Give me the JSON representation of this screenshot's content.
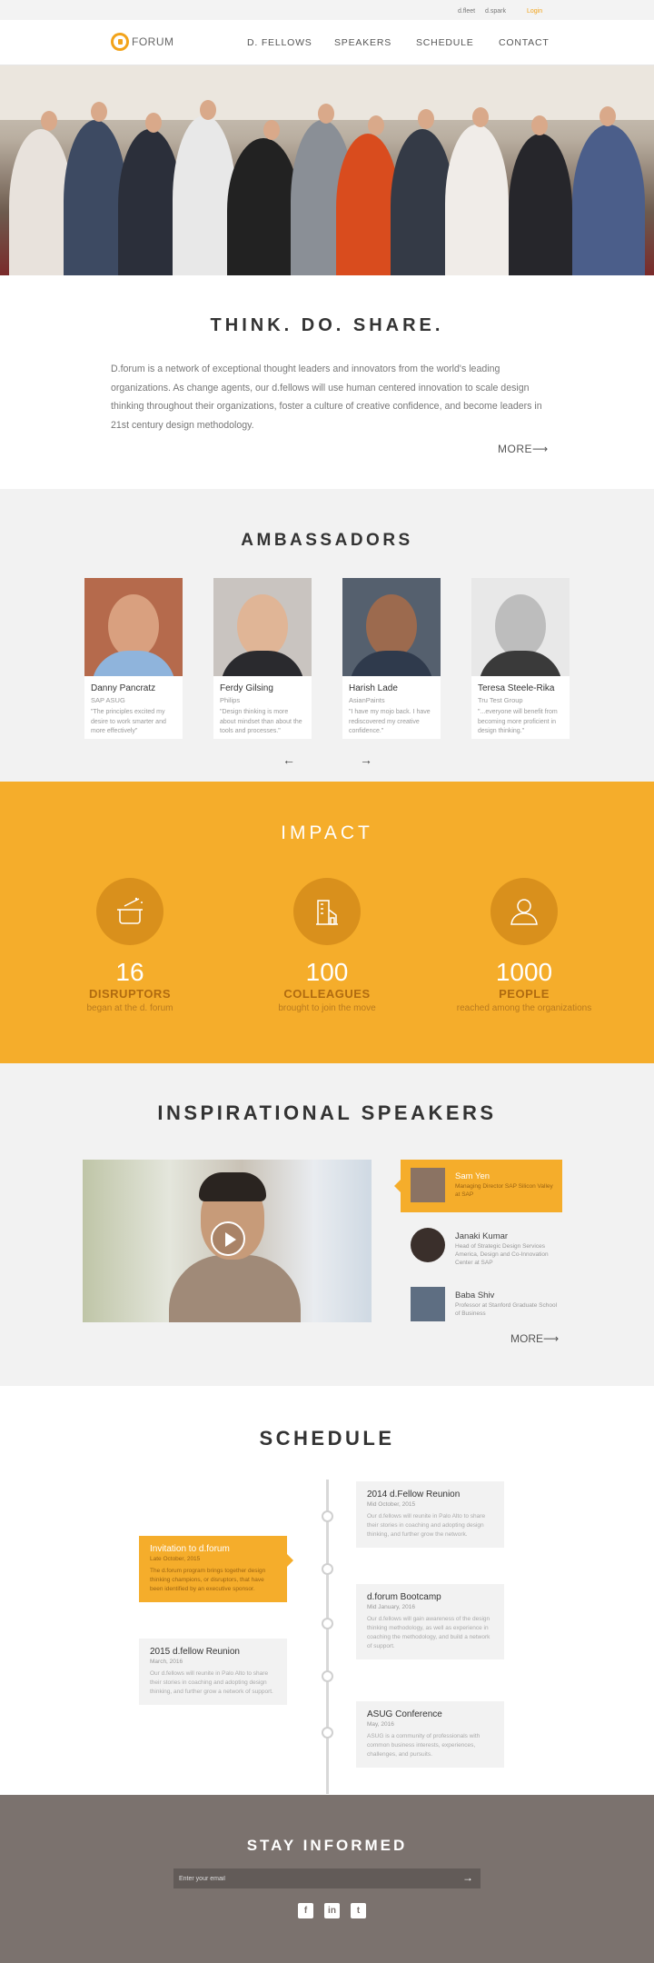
{
  "utility": {
    "link1": "d.fleet",
    "link2": "d.spark",
    "login": "Login"
  },
  "nav": {
    "logo": "FORUM",
    "items": [
      "D. FELLOWS",
      "SPEAKERS",
      "SCHEDULE",
      "CONTACT"
    ]
  },
  "intro": {
    "title": "THINK. DO. SHARE.",
    "text": "D.forum is a network of exceptional thought leaders and innovators from the world's leading organizations. As change agents, our d.fellows will use human centered innovation to scale design thinking throughout their organizations, foster a culture of creative confidence, and become leaders in 21st century design methodology.",
    "more": "MORE"
  },
  "ambassadors": {
    "title": "AMBASSADORS",
    "cards": [
      {
        "name": "Danny Pancratz",
        "company": "SAP ASUG",
        "quote": "\"The principles excited my desire to work smarter and more effectively\""
      },
      {
        "name": "Ferdy Gilsing",
        "company": "Philips",
        "quote": "\"Design thinking is more about mindset than about the tools and processes.\""
      },
      {
        "name": "Harish Lade",
        "company": "AsianPaints",
        "quote": "\"I have my mojo back. I have rediscovered my creative confidence.\""
      },
      {
        "name": "Teresa Steele-Rika",
        "company": "Tru Test Group",
        "quote": "\"...everyone will benefit from becoming more proficient in design thinking.\""
      }
    ],
    "prev": "←",
    "next": "→"
  },
  "impact": {
    "title": "IMPACT",
    "stats": [
      {
        "number": "16",
        "label": "DISRUPTORS",
        "sub": "began at the d. forum"
      },
      {
        "number": "100",
        "label": "COLLEAGUES",
        "sub": "brought to join the move"
      },
      {
        "number": "1000",
        "label": "PEOPLE",
        "sub": "reached among the organizations"
      }
    ]
  },
  "speakers": {
    "title": "INSPIRATIONAL SPEAKERS",
    "list": [
      {
        "name": "Sam Yen",
        "role": "Managing Director SAP Silicon Valley at SAP"
      },
      {
        "name": "Janaki Kumar",
        "role": "Head of Strategic Design Services America, Design and Co-Innovation Center at SAP"
      },
      {
        "name": "Baba Shiv",
        "role": "Professor at Stanford Graduate School of Business"
      }
    ],
    "more": "MORE"
  },
  "schedule": {
    "title": "SCHEDULE",
    "events": [
      {
        "title": "2014 d.Fellow Reunion",
        "date": "Mid October, 2015",
        "text": "Our d.fellows will reunite in Palo Alto to share their stories in coaching and adopting design thinking, and further grow the network."
      },
      {
        "title": "Invitation to d.forum",
        "date": "Late October, 2015",
        "text": "The d.forum program brings together design thinking champions, or disruptors, that have been identified by an executive sponsor."
      },
      {
        "title": "d.forum Bootcamp",
        "date": "Mid January, 2016",
        "text": "Our d.fellows will gain awareness of the design thinking methodology, as well as experience in coaching the methodology, and build a network of support."
      },
      {
        "title": "2015 d.fellow Reunion",
        "date": "March, 2016",
        "text": "Our d.fellows will reunite in Palo Alto to share their stories in coaching and adopting design thinking, and further grow a network of support."
      },
      {
        "title": "ASUG Conference",
        "date": "May, 2016",
        "text": "ASUG is a community of professionals with common business interests, experiences, challenges, and pursuits."
      }
    ]
  },
  "footer": {
    "title": "STAY INFORMED",
    "email_placeholder": "Enter your email",
    "submit": "→",
    "social": [
      "f",
      "in",
      "t"
    ]
  }
}
